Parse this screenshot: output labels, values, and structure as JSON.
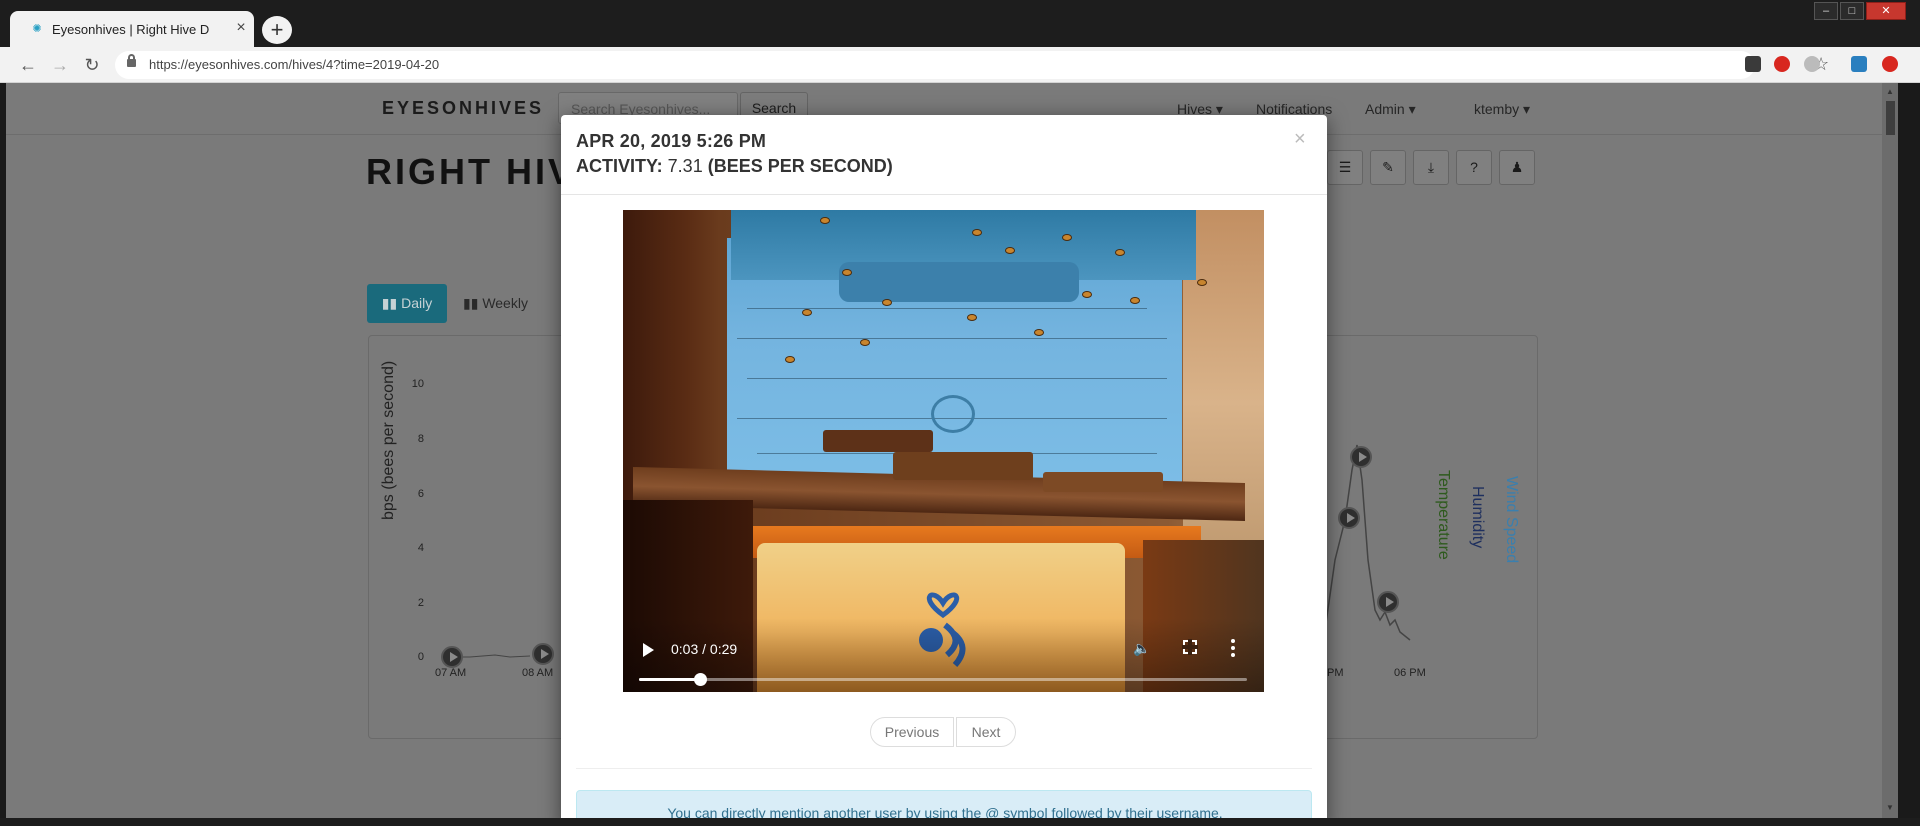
{
  "browser": {
    "tab_title": "Eyesonhives | Right Hive D",
    "url": "https://eyesonhives.com/hives/4?time=2019-04-20",
    "window_controls": [
      "minimize-icon",
      "maximize-icon",
      "close-icon"
    ]
  },
  "site": {
    "brand": "EYESONHIVES",
    "search_placeholder": "Search Eyesonhives...",
    "search_button": "Search",
    "nav": [
      "Hives",
      "Notifications",
      "Admin",
      "ktemby"
    ]
  },
  "hive": {
    "title": "RIGHT HIVE D",
    "view_buttons": {
      "daily": "Daily",
      "weekly": "Weekly"
    }
  },
  "chart": {
    "ylabel": "bps (bees per second)",
    "yticks": [
      "10",
      "8",
      "6",
      "4",
      "2",
      "0"
    ],
    "xticks": [
      "07 AM",
      "08 AM",
      "PM",
      "06 PM"
    ],
    "right_labels": {
      "temperature": "Temperature",
      "humidity": "Humidity",
      "wind": "Wind Speed"
    },
    "colors": {
      "temperature": "#2e5a1d",
      "humidity": "#1e2f5e",
      "wind": "#3a7fae"
    }
  },
  "modal": {
    "date": "APR 20, 2019 5:26 PM",
    "activity_label": "ACTIVITY: ",
    "activity_value": "7.31",
    "activity_unit": " (BEES PER SECOND)",
    "close": "×",
    "video": {
      "time": "0:03 / 0:29",
      "progress_fraction": 0.1
    },
    "pager": {
      "previous": "Previous",
      "next": "Next"
    },
    "info": "You can directly mention another user by using the @ symbol followed by their username."
  }
}
